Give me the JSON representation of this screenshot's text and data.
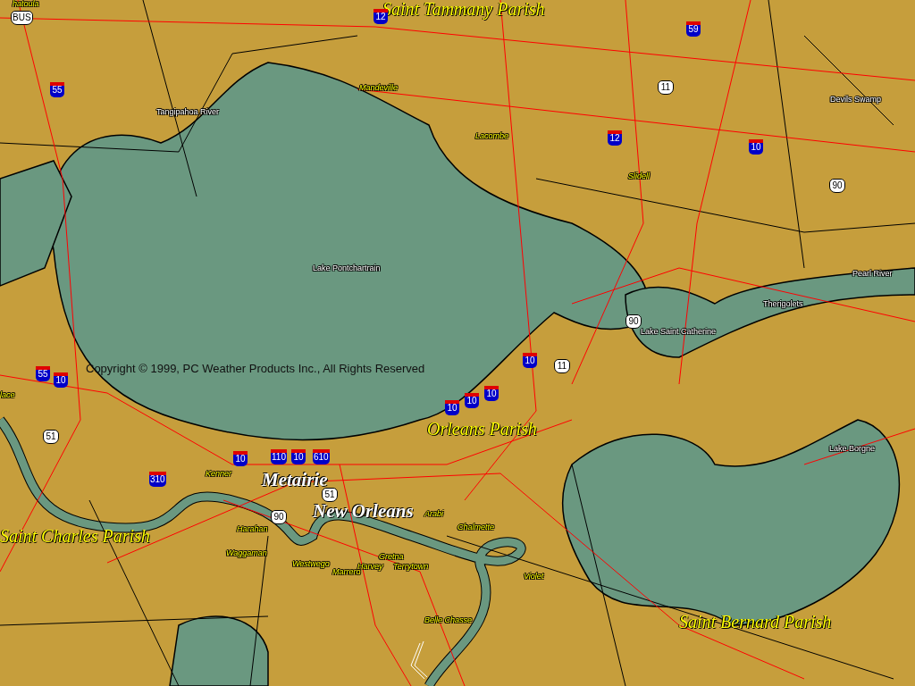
{
  "map": {
    "parishes": [
      "Saint Tammany Parish",
      "Orleans Parish",
      "Saint Charles Parish",
      "Saint Bernard Parish"
    ],
    "cities": [
      "Metairie",
      "New Orleans"
    ],
    "towns": [
      "hatoula",
      "Mandeville",
      "Lacombe",
      "Slidell",
      "lace",
      "Kenner",
      "Harahan",
      "Waggaman",
      "Westwego",
      "Marrero",
      "Harvey",
      "Gretna",
      "Terrytown",
      "Arabi",
      "Chalmette",
      "Violet",
      "Belle Chasse"
    ],
    "features": [
      "Tangipahoa River",
      "Devils Swamp",
      "Lake Pontchartrain",
      "Pearl River",
      "Therigolets",
      "Lake Saint Catherine",
      "Lake Borgne"
    ],
    "interstate_shields": [
      "12",
      "55",
      "59",
      "12",
      "10",
      "55",
      "10",
      "10",
      "310",
      "110",
      "10",
      "610",
      "10",
      "10",
      "10",
      "10"
    ],
    "us_shields": [
      "BUS",
      "11",
      "90",
      "11",
      "51",
      "51",
      "90",
      "90"
    ],
    "copyright": "Copyright © 1999, PC Weather Products Inc., All Rights Reserved"
  }
}
